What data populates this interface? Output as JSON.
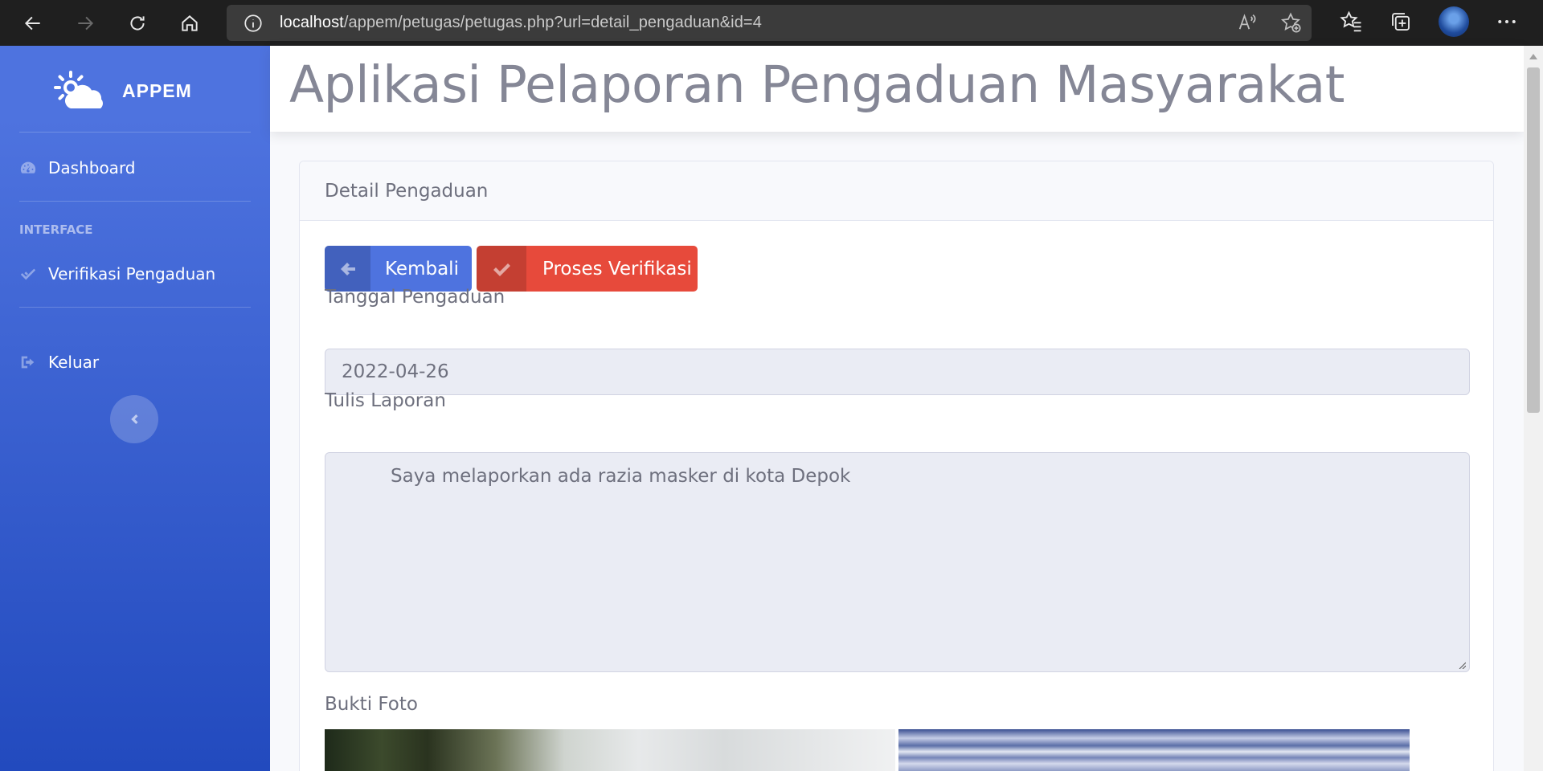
{
  "browser": {
    "url_host": "localhost",
    "url_path": "/appem/petugas/petugas.php?url=detail_pengaduan&id=4"
  },
  "sidebar": {
    "brand": "APPEM",
    "items": [
      {
        "label": "Dashboard",
        "icon": "tachometer-icon"
      },
      {
        "label": "Verifikasi Pengaduan",
        "icon": "check-double-icon"
      },
      {
        "label": "Keluar",
        "icon": "sign-out-icon"
      }
    ],
    "heading": "INTERFACE"
  },
  "topbar": {
    "title": "Aplikasi Pelaporan Pengaduan Masyarakat"
  },
  "card": {
    "title": "Detail Pengaduan",
    "back_label": "Kembali",
    "verify_label": "Proses Verifikasi",
    "date_label": "Tanggal Pengaduan",
    "date_value": "2022-04-26",
    "report_label": "Tulis Laporan",
    "report_value": "Saya melaporkan ada razia masker di kota Depok",
    "photo_label": "Bukti Foto"
  },
  "colors": {
    "primary": "#4e73df",
    "danger": "#e74a3b",
    "text_muted": "#6e707e"
  }
}
